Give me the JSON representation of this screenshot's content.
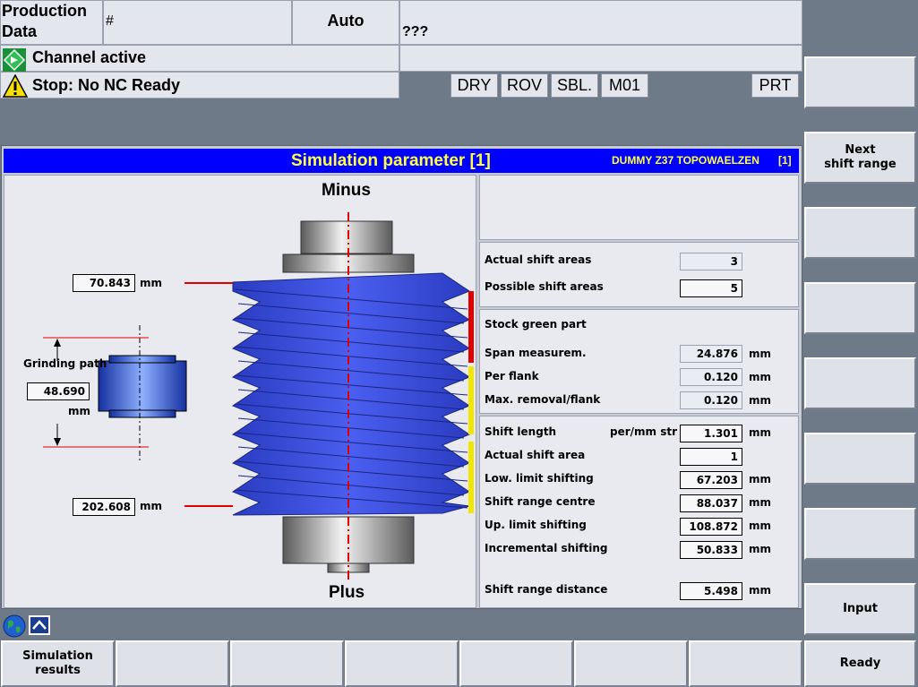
{
  "header": {
    "area_line1": "Production",
    "area_line2": "Data",
    "program": "#",
    "mode": "Auto",
    "status_extra": "???",
    "channel_status": "Channel active",
    "alarm": "Stop: No NC Ready",
    "flags": [
      "DRY",
      "ROV",
      "SBL.",
      "M01"
    ],
    "prt": "PRT"
  },
  "dialog": {
    "title": "Simulation parameter [1]",
    "subtitle": "DUMMY Z37 TOPOWAELZEN",
    "subtitle_index": "[1]"
  },
  "diagram": {
    "minus_label": "Minus",
    "plus_label": "Plus",
    "top_value": "70.843",
    "top_unit": "mm",
    "bottom_value": "202.608",
    "bottom_unit": "mm",
    "grinding_path_label": "Grinding path",
    "grinding_path_value": "48.690",
    "grinding_path_unit": "mm",
    "colors": {
      "worm": "#3b4fe0",
      "marker_red": "#e00000",
      "marker_yellow": "#f0e600",
      "axis": "#e00000"
    }
  },
  "params": {
    "actual_shift_areas": {
      "label": "Actual shift areas",
      "value": "3"
    },
    "possible_shift_areas": {
      "label": "Possible shift areas",
      "value": "5"
    },
    "stock_heading": "Stock green part",
    "span": {
      "label": "Span measurem.",
      "value": "24.876",
      "unit": "mm"
    },
    "per_flank": {
      "label": "Per flank",
      "value": "0.120",
      "unit": "mm"
    },
    "max_removal": {
      "label": "Max. removal/flank",
      "value": "0.120",
      "unit": "mm"
    },
    "shift_length": {
      "label": "Shift length",
      "sublabel": "per/mm str",
      "value": "1.301",
      "unit": "mm"
    },
    "actual_shift_area": {
      "label": "Actual shift area",
      "value": "1"
    },
    "low_limit": {
      "label": "Low. limit shifting",
      "value": "67.203",
      "unit": "mm"
    },
    "centre": {
      "label": "Shift range centre",
      "value": "88.037",
      "unit": "mm"
    },
    "up_limit": {
      "label": "Up. limit shifting",
      "value": "108.872",
      "unit": "mm"
    },
    "incremental": {
      "label": "Incremental shifting",
      "value": "50.833",
      "unit": "mm"
    },
    "distance": {
      "label": "Shift range distance",
      "value": "5.498",
      "unit": "mm"
    }
  },
  "softkeys_vertical": [
    {
      "line1": "",
      "line2": ""
    },
    {
      "line1": "Next",
      "line2": "shift range"
    },
    {
      "line1": "",
      "line2": ""
    },
    {
      "line1": "",
      "line2": ""
    },
    {
      "line1": "",
      "line2": ""
    },
    {
      "line1": "",
      "line2": ""
    },
    {
      "line1": "",
      "line2": ""
    },
    {
      "line1": "Input",
      "line2": ""
    },
    {
      "line1": "Ready",
      "line2": ""
    }
  ],
  "softkeys_horizontal": [
    {
      "line1": "Simulation",
      "line2": "results"
    },
    {
      "line1": "",
      "line2": ""
    },
    {
      "line1": "",
      "line2": ""
    },
    {
      "line1": "",
      "line2": ""
    },
    {
      "line1": "",
      "line2": ""
    },
    {
      "line1": "",
      "line2": ""
    },
    {
      "line1": "",
      "line2": ""
    }
  ]
}
